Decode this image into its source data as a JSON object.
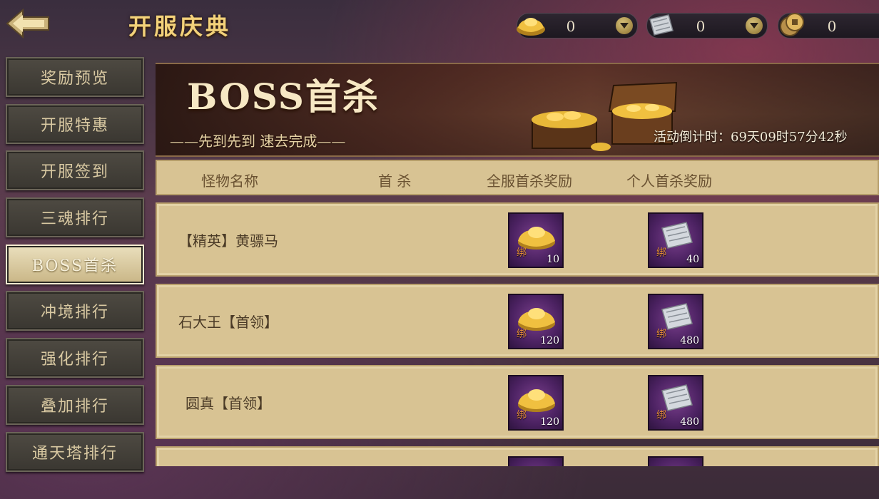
{
  "header": {
    "title": "开服庆典",
    "currencies": [
      {
        "icon": "gold-ingot-icon",
        "value": "0"
      },
      {
        "icon": "silver-note-icon",
        "value": "0"
      },
      {
        "icon": "copper-coins-icon",
        "value": "0"
      }
    ]
  },
  "sidebar": {
    "items": [
      {
        "label": "奖励预览"
      },
      {
        "label": "开服特惠"
      },
      {
        "label": "开服签到"
      },
      {
        "label": "三魂排行"
      },
      {
        "label": "BOSS首杀",
        "active": true
      },
      {
        "label": "冲境排行"
      },
      {
        "label": "强化排行"
      },
      {
        "label": "叠加排行"
      },
      {
        "label": "通天塔排行"
      }
    ]
  },
  "banner": {
    "title": "BOSS首杀",
    "subtitle": "——先到先到 速去完成——",
    "countdown": "活动倒计时：69天09时57分42秒"
  },
  "table": {
    "headers": {
      "name": "怪物名称",
      "first_kill": "首 杀",
      "server_reward": "全服首杀奖励",
      "personal_reward": "个人首杀奖励"
    },
    "rows": [
      {
        "name": "【精英】黄骠马",
        "server_reward": {
          "icon": "gold-ingot-icon",
          "bind": "绑",
          "qty": "10"
        },
        "personal_reward": {
          "icon": "silver-note-icon",
          "bind": "绑",
          "qty": "40"
        }
      },
      {
        "name": "石大王【首领】",
        "server_reward": {
          "icon": "gold-ingot-icon",
          "bind": "绑",
          "qty": "120"
        },
        "personal_reward": {
          "icon": "silver-note-icon",
          "bind": "绑",
          "qty": "480"
        }
      },
      {
        "name": "圆真【首领】",
        "server_reward": {
          "icon": "gold-ingot-icon",
          "bind": "绑",
          "qty": "120"
        },
        "personal_reward": {
          "icon": "silver-note-icon",
          "bind": "绑",
          "qty": "480"
        }
      },
      {
        "name": "",
        "server_reward": {
          "icon": "gold-ingot-icon",
          "bind": "",
          "qty": ""
        },
        "personal_reward": {
          "icon": "silver-note-icon",
          "bind": "",
          "qty": ""
        }
      }
    ]
  }
}
